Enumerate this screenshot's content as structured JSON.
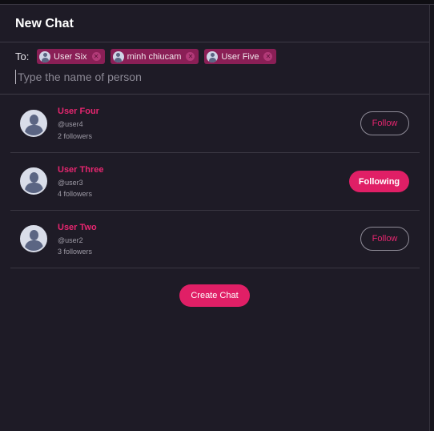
{
  "header": {
    "title": "New Chat"
  },
  "recipients": {
    "to_label": "To:",
    "chips": [
      {
        "name": "User Six"
      },
      {
        "name": "minh chiucam"
      },
      {
        "name": "User Five"
      }
    ],
    "chip_remove_glyph": "✕"
  },
  "search": {
    "placeholder": "Type the name of person",
    "value": ""
  },
  "users": [
    {
      "name": "User Four",
      "handle": "@user4",
      "followers": "2 followers",
      "action": "Follow",
      "following": false
    },
    {
      "name": "User Three",
      "handle": "@user3",
      "followers": "4 followers",
      "action": "Following",
      "following": true
    },
    {
      "name": "User Two",
      "handle": "@user2",
      "followers": "3 followers",
      "action": "Follow",
      "following": false
    }
  ],
  "create_button": {
    "label": "Create Chat"
  },
  "colors": {
    "accent": "#e01f66",
    "chip_bg": "#8a1f56",
    "background": "#1e1b26",
    "name_text": "#e5266f"
  }
}
